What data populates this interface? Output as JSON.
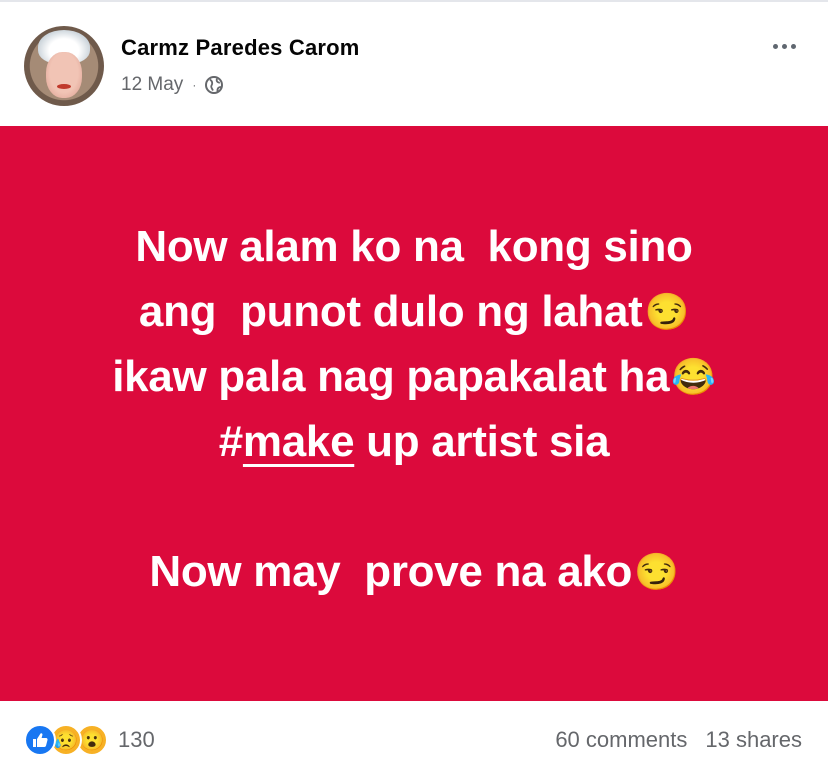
{
  "post": {
    "author": "Carmz Paredes Carom",
    "date": "12 May",
    "date_separator": "·",
    "privacy_icon": "globe-icon",
    "more_icon": "more-options-icon",
    "background_color": "#dc0a3c",
    "text_color": "#ffffff",
    "lines": [
      "Now alam ko na  kong sino",
      "ang  punot dulo ng lahat",
      "ikaw pala nag papakalat ha",
      "#",
      "make",
      " up artist sia",
      "Now may  prove na ako"
    ],
    "emojis": {
      "smirk": "😏",
      "joy": "😂"
    }
  },
  "footer": {
    "reaction_icons": [
      "like-icon",
      "sad-icon",
      "wow-icon"
    ],
    "reaction_emojis": {
      "sad": "😥",
      "wow": "😮"
    },
    "reaction_count": "130",
    "comments": "60 comments",
    "shares": "13 shares"
  }
}
